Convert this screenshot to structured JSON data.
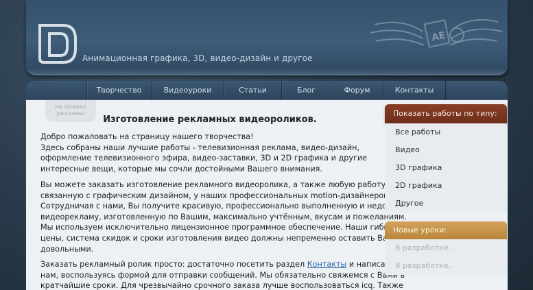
{
  "header": {
    "tagline": "Анимационная графика, 3D, видео-дизайн и другое",
    "emblem_text": "AE"
  },
  "nav": {
    "items": [
      "Творчество",
      "Видеоуроки",
      "Статьи",
      "Блог",
      "Форум",
      "Контакты"
    ]
  },
  "badge": {
    "line1": "на правах",
    "line2": "рекламы"
  },
  "main": {
    "title": "Изготовление рекламных видеороликов.",
    "para1": [
      "   Добро пожаловать на страницу нашего творчества!",
      "Здесь собраны наши лучшие работы - телевизионная реклама, видео-дизайн,",
      "оформление телевизионного эфира, видео-заставки, 3D и 2D графика и другие",
      "интересные вещи, которые мы сочли достойными Вашего внимания."
    ],
    "para2": [
      "   Вы можете заказать изготовление рекламного видеоролика, а также любую работу,",
      "связанную с графическим дизайном, у наших профессиональных motion-дизайнеров.",
      "Сотрудничая с нами, Вы получите красивую, профессионально выполненную и недорогую",
      "видеорекламу, изготовленную по Вашим, максимально учтённым, вкусам и пожеланиям.",
      "Мы используем исключительно лицензионное программное обеспечение. Наши гибкие",
      "цены, система скидок и сроки изготовления видео должны непременно оставить Вас",
      "довольными."
    ],
    "para3_before_link": "   Заказать рекламный ролик просто: достаточно посетить раздел ",
    "para3_link": "Контакты",
    "para3_after_link": " и написать",
    "para3_rest": [
      "нам, воспользуясь формой для отправки сообщений. Мы обязательно свяжемся с Вами в",
      "кратчайшие сроки. Для чрезвычайно срочного заказа лучше воспользоваться icq. Также"
    ]
  },
  "sidebar": {
    "works_title": "Показать работы по типу:",
    "works_items": [
      "Все работы",
      "Видео",
      "3D графика",
      "2D графика",
      "Другое"
    ],
    "lessons_title": "Новые уроки:",
    "lessons_items": [
      "В разработке..",
      "В разработке.."
    ]
  },
  "colors": {
    "nav_bg": "#2c445b",
    "sidebar_head": "#7a341d",
    "lessons_head": "#c4924a",
    "link": "#2a67a8"
  }
}
